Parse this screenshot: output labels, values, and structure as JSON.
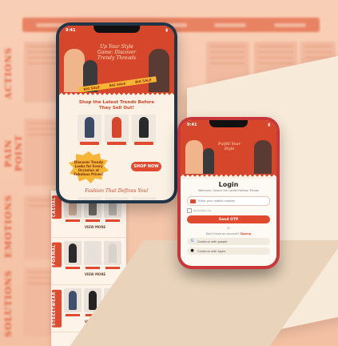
{
  "background": {
    "row_labels": [
      "ACTIONS",
      "PAIN POINT",
      "EMOTIONS",
      "SOLUTIONS"
    ]
  },
  "phone1": {
    "status_time": "9:41",
    "hero_tagline": "Up Your Style Game: Discover Trendy Threads",
    "hero_ribbon": [
      "BIG SALE",
      "BIG SALE",
      "BIG SALE"
    ],
    "shop_title": "Shop the Latest Trends Before They Sell Out!",
    "promo_text": "Discover Trendy Looks for Every Occasion at Fabulous Prices!",
    "shop_now_label": "SHOP NOW",
    "script_text": "Fashion That Defines You!"
  },
  "strip": {
    "sections": [
      {
        "tag": "CASUAL",
        "view_more": "VIEW MORE"
      },
      {
        "tag": "FORMAL",
        "view_more": "VIEW MORE"
      },
      {
        "tag": "STREETWEAR",
        "view_more": "VIEW MORE"
      }
    ]
  },
  "phone2": {
    "status_time": "9:41",
    "hero_tagline": "Fulfill Your Style",
    "title": "Login",
    "subtitle": "Welcome, Unlock the Latest Fashion Trends",
    "phone_placeholder": "Enter your mobile number",
    "remember_label": "Remember me",
    "send_otp_label": "Send OTP",
    "divider": "Or",
    "signup_prefix": "Don't have an account?",
    "signup_link": "Signup",
    "google_label": "Continue with google",
    "apple_label": "Continue with Apple"
  },
  "colors": {
    "brand_red": "#e24a2f",
    "hero_red": "#d6462b",
    "accent_yellow": "#f6b534",
    "cream": "#fbf2e5"
  }
}
